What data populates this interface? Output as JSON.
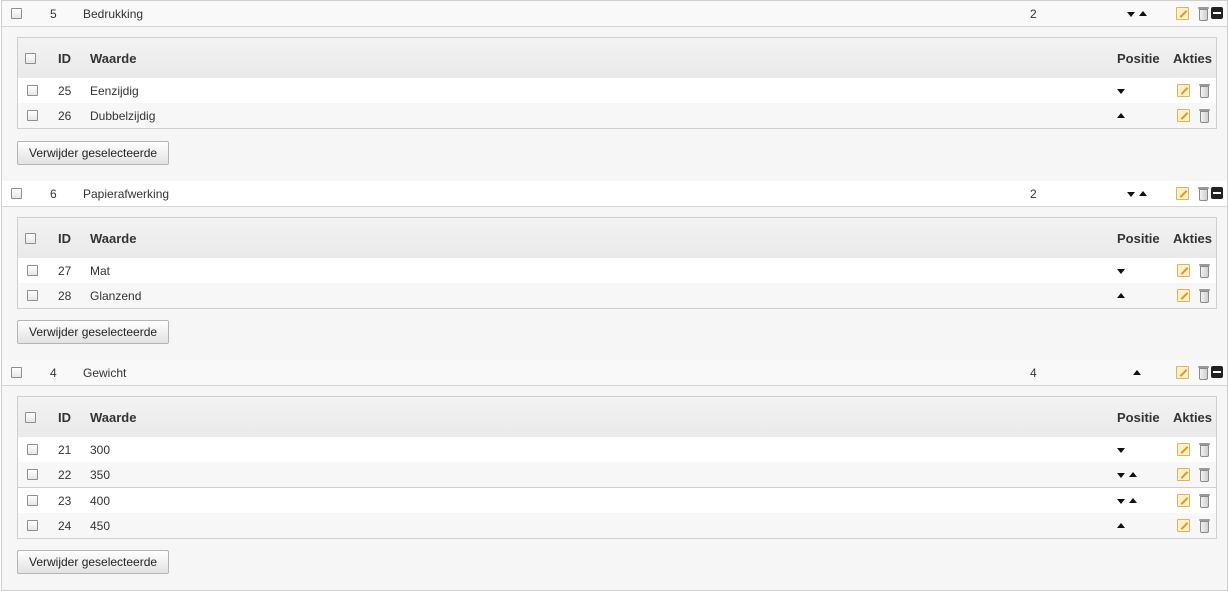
{
  "headers": {
    "id": "ID",
    "waarde": "Waarde",
    "positie": "Positie",
    "akties": "Akties"
  },
  "button_label": "Verwijder geselecteerde",
  "groups": [
    {
      "id": "5",
      "name": "Bedrukking",
      "count": "2",
      "values": [
        {
          "id": "25",
          "value": "Eenzijdig"
        },
        {
          "id": "26",
          "value": "Dubbelzijdig"
        }
      ]
    },
    {
      "id": "6",
      "name": "Papierafwerking",
      "count": "2",
      "values": [
        {
          "id": "27",
          "value": "Mat"
        },
        {
          "id": "28",
          "value": "Glanzend"
        }
      ]
    },
    {
      "id": "4",
      "name": "Gewicht",
      "count": "4",
      "values": [
        {
          "id": "21",
          "value": "300"
        },
        {
          "id": "22",
          "value": "350"
        },
        {
          "id": "23",
          "value": "400"
        },
        {
          "id": "24",
          "value": "450"
        }
      ]
    }
  ]
}
